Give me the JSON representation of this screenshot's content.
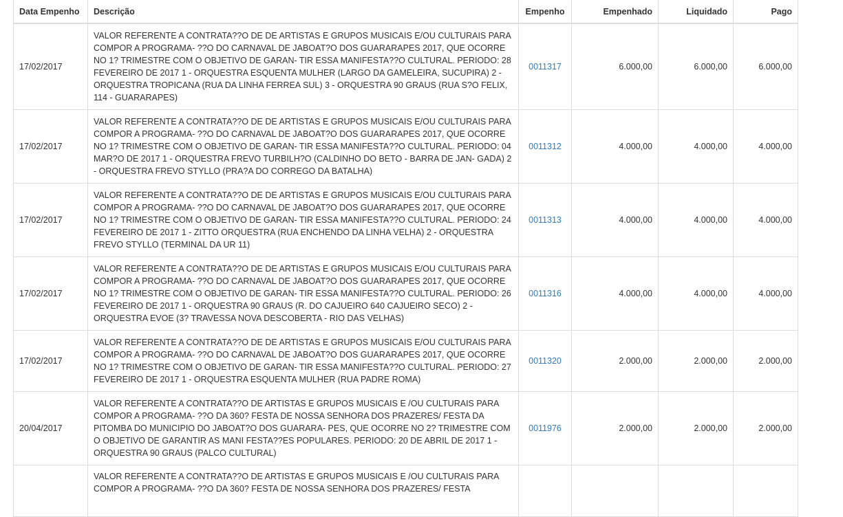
{
  "table": {
    "headers": {
      "data_empenho": "Data Empenho",
      "descricao": "Descrição",
      "empenho": "Empenho",
      "empenhado": "Empenhado",
      "liquidado": "Liquidado",
      "pago": "Pago"
    },
    "rows": [
      {
        "date": "17/02/2017",
        "description": "VALOR REFERENTE A CONTRATA??O DE DE ARTISTAS E GRUPOS MUSICAIS E/OU CULTURAIS PARA COMPOR A PROGRAMA- ??O DO CARNAVAL DE JABOAT?O DOS GUARARAPES 2017, QUE OCORRE NO 1? TRIMESTRE COM O OBJETIVO DE GARAN- TIR ESSA MANIFESTA??O CULTURAL. PERIODO: 28 FEVEREIRO DE 2017 1 - ORQUESTRA ESQUENTA MULHER (LARGO DA GAMELEIRA, SUCUPIRA) 2 - ORQUESTRA TROPICANA (RUA DA LINHA FERREA SUL) 3 - ORQUESTRA 90 GRAUS (RUA S?O FELIX, 114 - GUARARAPES)",
        "empenho": "0011317",
        "empenhado": "6.000,00",
        "liquidado": "6.000,00",
        "pago": "6.000,00"
      },
      {
        "date": "17/02/2017",
        "description": "VALOR REFERENTE A CONTRATA??O DE DE ARTISTAS E GRUPOS MUSICAIS E/OU CULTURAIS PARA COMPOR A PROGRAMA- ??O DO CARNAVAL DE JABOAT?O DOS GUARARAPES 2017, QUE OCORRE NO 1? TRIMESTRE COM O OBJETIVO DE GARAN- TIR ESSA MANIFESTA??O CULTURAL. PERIODO: 04 MAR?O DE 2017 1 - ORQUESTRA FREVO TURBILH?O (CALDINHO DO BETO - BARRA DE JAN- GADA) 2 - ORQUESTRA FREVO STYLLO (PRA?A DO CORREGO DA BATALHA)",
        "empenho": "0011312",
        "empenhado": "4.000,00",
        "liquidado": "4.000,00",
        "pago": "4.000,00"
      },
      {
        "date": "17/02/2017",
        "description": "VALOR REFERENTE A CONTRATA??O DE DE ARTISTAS E GRUPOS MUSICAIS E/OU CULTURAIS PARA COMPOR A PROGRAMA- ??O DO CARNAVAL DE JABOAT?O DOS GUARARAPES 2017, QUE OCORRE NO 1? TRIMESTRE COM O OBJETIVO DE GARAN- TIR ESSA MANIFESTA??O CULTURAL. PERIODO: 24 FEVEREIRO DE 2017 1 - ZITTO ORQUESTRA (RUA ENCHENDO DA LINHA VELHA) 2 - ORQUESTRA FREVO STYLLO (TERMINAL DA UR 11)",
        "empenho": "0011313",
        "empenhado": "4.000,00",
        "liquidado": "4.000,00",
        "pago": "4.000,00"
      },
      {
        "date": "17/02/2017",
        "description": "VALOR REFERENTE A CONTRATA??O DE DE ARTISTAS E GRUPOS MUSICAIS E/OU CULTURAIS PARA COMPOR A PROGRAMA- ??O DO CARNAVAL DE JABOAT?O DOS GUARARAPES 2017, QUE OCORRE NO 1? TRIMESTRE COM O OBJETIVO DE GARAN- TIR ESSA MANIFESTA??O CULTURAL. PERIODO: 26 FEVEREIRO DE 2017 1 - ORQUESTRA 90 GRAUS (R. DO CAJUEIRO 640 CAJUEIRO SECO) 2 - ORQUESTRA EVOE (3? TRAVESSA NOVA DESCOBERTA - RIO DAS VELHAS)",
        "empenho": "0011316",
        "empenhado": "4.000,00",
        "liquidado": "4.000,00",
        "pago": "4.000,00"
      },
      {
        "date": "17/02/2017",
        "description": "VALOR REFERENTE A CONTRATA??O DE DE ARTISTAS E GRUPOS MUSICAIS E/OU CULTURAIS PARA COMPOR A PROGRAMA- ??O DO CARNAVAL DE JABOAT?O DOS GUARARAPES 2017, QUE OCORRE NO 1? TRIMESTRE COM O OBJETIVO DE GARAN- TIR ESSA MANIFESTA??O CULTURAL. PERIODO: 27 FEVEREIRO DE 2017 1 - ORQUESTRA ESQUENTA MULHER (RUA PADRE ROMA)",
        "empenho": "0011320",
        "empenhado": "2.000,00",
        "liquidado": "2.000,00",
        "pago": "2.000,00"
      },
      {
        "date": "20/04/2017",
        "description": "VALOR REFERENTE A CONTRATA??O DE ARTISTAS E GRUPOS MUSICAIS E /OU CULTURAIS PARA COMPOR A PROGRAMA- ??O DA 360? FESTA DE NOSSA SENHORA DOS PRAZERES/ FESTA DA PITOMBA DO MUNICIPIO DO JABOAT?O DOS GUARARA- PES, QUE OCORRE NO 2? TRIMESTRE COM O OBJETIVO DE GARANTIR AS MANI FESTA??ES POPULARES. PERIODO: 20 DE ABRIL DE 2017 1 - ORQUESTRA 90 GRAUS (PALCO CULTURAL)",
        "empenho": "0011976",
        "empenhado": "2.000,00",
        "liquidado": "2.000,00",
        "pago": "2.000,00"
      },
      {
        "date": "",
        "description": "VALOR REFERENTE A CONTRATA??O DE ARTISTAS E GRUPOS MUSICAIS E /OU CULTURAIS PARA COMPOR A PROGRAMA- ??O DA 360? FESTA DE NOSSA SENHORA DOS PRAZERES/ FESTA",
        "empenho": "",
        "empenhado": "",
        "liquidado": "",
        "pago": ""
      }
    ]
  }
}
